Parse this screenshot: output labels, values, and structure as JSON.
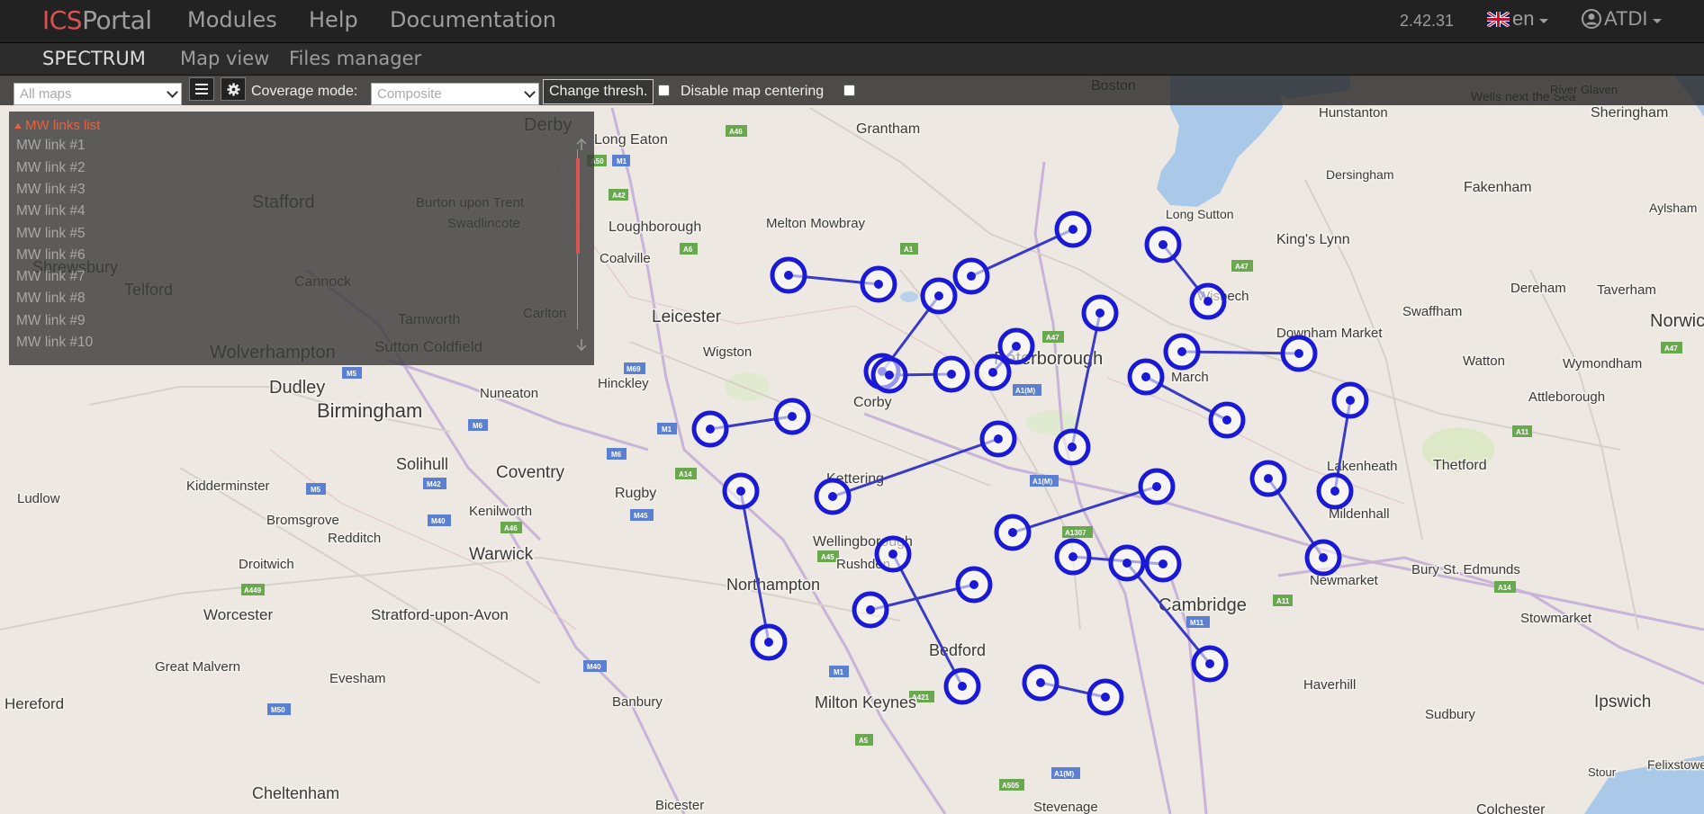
{
  "header": {
    "brand_ics": "ICS",
    "brand_portal": "Portal",
    "nav": [
      "Modules",
      "Help",
      "Documentation"
    ],
    "version": "2.42.31",
    "lang": "en",
    "user": "ATDI"
  },
  "subnav": {
    "items": [
      "SPECTRUM",
      "Map view",
      "Files manager"
    ],
    "active": "SPECTRUM"
  },
  "toolbar": {
    "maps_placeholder": "All maps",
    "coverage_label": "Coverage mode:",
    "coverage_value": "Composite",
    "thresh_button": "Change thresh.",
    "disable_centering_label": "Disable map centering"
  },
  "links_panel": {
    "title": "MW links list",
    "items": [
      "MW link #1",
      "MW link #2",
      "MW link #3",
      "MW link #4",
      "MW link #5",
      "MW link #6",
      "MW link #7",
      "MW link #8",
      "MW link #9",
      "MW link #10"
    ]
  },
  "map": {
    "places": [
      {
        "name": "Derby",
        "size": 20
      },
      {
        "name": "Long Eaton",
        "size": 16
      },
      {
        "name": "Grantham",
        "size": 16
      },
      {
        "name": "Boston",
        "size": 16
      },
      {
        "name": "Hunstanton",
        "size": 15
      },
      {
        "name": "Wells next the Sea",
        "size": 14
      },
      {
        "name": "River Glaven",
        "size": 13
      },
      {
        "name": "Sheringham",
        "size": 16
      },
      {
        "name": "Stafford",
        "size": 20
      },
      {
        "name": "Burton upon Trent",
        "size": 15
      },
      {
        "name": "Swadlincote",
        "size": 15
      },
      {
        "name": "Shrewsbury",
        "size": 18
      },
      {
        "name": "Telford",
        "size": 18
      },
      {
        "name": "Cannock",
        "size": 16
      },
      {
        "name": "Tamworth",
        "size": 16
      },
      {
        "name": "Carlton",
        "size": 15
      },
      {
        "name": "Wolverhampton",
        "size": 20
      },
      {
        "name": "Sutton Coldfield",
        "size": 17
      },
      {
        "name": "Dudley",
        "size": 20
      },
      {
        "name": "Birmingham",
        "size": 22
      },
      {
        "name": "Loughborough",
        "size": 16
      },
      {
        "name": "Coalville",
        "size": 15
      },
      {
        "name": "Melton Mowbray",
        "size": 15
      },
      {
        "name": "Leicester",
        "size": 19
      },
      {
        "name": "Wigston",
        "size": 15
      },
      {
        "name": "Hinckley",
        "size": 15
      },
      {
        "name": "Nuneaton",
        "size": 15
      },
      {
        "name": "Corby",
        "size": 16
      },
      {
        "name": "Peterborough",
        "size": 20
      },
      {
        "name": "March",
        "size": 15
      },
      {
        "name": "Long Sutton",
        "size": 14
      },
      {
        "name": "King's Lynn",
        "size": 16
      },
      {
        "name": "Wisbech",
        "size": 15
      },
      {
        "name": "Downham Market",
        "size": 15
      },
      {
        "name": "Dersingham",
        "size": 14
      },
      {
        "name": "Fakenham",
        "size": 16
      },
      {
        "name": "Aylsham",
        "size": 14
      },
      {
        "name": "Swaffham",
        "size": 15
      },
      {
        "name": "Dereham",
        "size": 15
      },
      {
        "name": "Taverham",
        "size": 15
      },
      {
        "name": "Norwich",
        "size": 20
      },
      {
        "name": "Watton",
        "size": 15
      },
      {
        "name": "Wymondham",
        "size": 15
      },
      {
        "name": "Attleborough",
        "size": 15
      },
      {
        "name": "Thetford",
        "size": 16
      },
      {
        "name": "Lakenheath",
        "size": 15
      },
      {
        "name": "Mildenhall",
        "size": 15
      },
      {
        "name": "Kidderminster",
        "size": 15
      },
      {
        "name": "Solihull",
        "size": 18
      },
      {
        "name": "Coventry",
        "size": 19
      },
      {
        "name": "Rugby",
        "size": 16
      },
      {
        "name": "Kettering",
        "size": 16
      },
      {
        "name": "Ludlow",
        "size": 15
      },
      {
        "name": "Bromsgrove",
        "size": 15
      },
      {
        "name": "Kenilworth",
        "size": 15
      },
      {
        "name": "Redditch",
        "size": 15
      },
      {
        "name": "Droitwich",
        "size": 15
      },
      {
        "name": "Warwick",
        "size": 19
      },
      {
        "name": "Wellingborough",
        "size": 16
      },
      {
        "name": "Rushden",
        "size": 15
      },
      {
        "name": "Northampton",
        "size": 18
      },
      {
        "name": "Cambridge",
        "size": 20
      },
      {
        "name": "Newmarket",
        "size": 15
      },
      {
        "name": "Bury St. Edmunds",
        "size": 15
      },
      {
        "name": "Stowmarket",
        "size": 15
      },
      {
        "name": "Worcester",
        "size": 17
      },
      {
        "name": "Stratford-upon-Avon",
        "size": 17
      },
      {
        "name": "Great Malvern",
        "size": 15
      },
      {
        "name": "Evesham",
        "size": 15
      },
      {
        "name": "Banbury",
        "size": 15
      },
      {
        "name": "Bedford",
        "size": 18
      },
      {
        "name": "Milton Keynes",
        "size": 18
      },
      {
        "name": "Haverhill",
        "size": 15
      },
      {
        "name": "Sudbury",
        "size": 15
      },
      {
        "name": "Ipswich",
        "size": 19
      },
      {
        "name": "Hereford",
        "size": 17
      },
      {
        "name": "Cheltenham",
        "size": 18
      },
      {
        "name": "Bicester",
        "size": 15
      },
      {
        "name": "Stevenage",
        "size": 15
      },
      {
        "name": "Felixstowe",
        "size": 14
      },
      {
        "name": "Stour",
        "size": 13
      },
      {
        "name": "Colchester",
        "size": 16
      }
    ],
    "road_labels": [
      "A46",
      "A50",
      "M1",
      "A42",
      "A6",
      "A1",
      "M6",
      "A5",
      "M54",
      "M42",
      "A47",
      "A14",
      "M69",
      "M5",
      "M40",
      "A45",
      "A1(M)",
      "A11",
      "A1307",
      "M11",
      "A421",
      "A505",
      "A428",
      "A449",
      "M50",
      "A1(M)"
    ]
  },
  "colors": {
    "accent": "#d9534f",
    "link_marker": "#1a1ad6",
    "link_line": "#3a3ac8",
    "navbar": "#222222",
    "map_bg": "#ede9e2",
    "water": "#aac8e8"
  }
}
